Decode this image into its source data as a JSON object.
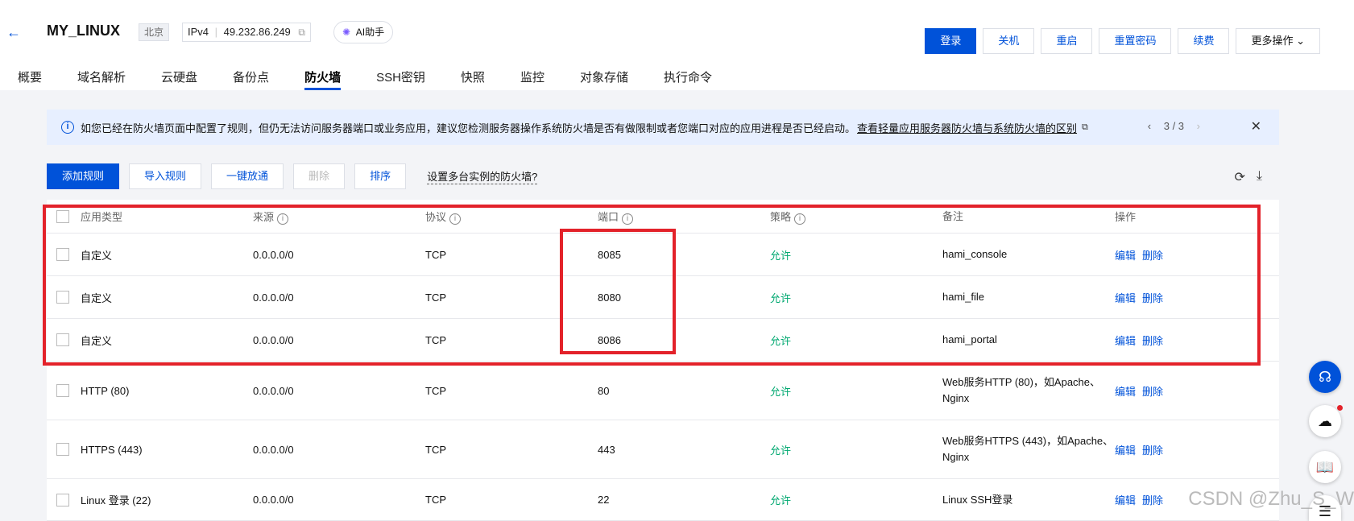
{
  "header": {
    "back_icon": "arrow-left-icon",
    "title": "MY_LINUX",
    "region": "北京",
    "ip_label": "IPv4",
    "ip_value": "49.232.86.249",
    "ai_label": "AI助手"
  },
  "actions": {
    "login": "登录",
    "shutdown": "关机",
    "restart": "重启",
    "reset_password": "重置密码",
    "renew": "续费",
    "more": "更多操作 ⌄"
  },
  "tabs": [
    {
      "label": "概要"
    },
    {
      "label": "域名解析"
    },
    {
      "label": "云硬盘"
    },
    {
      "label": "备份点"
    },
    {
      "label": "防火墙"
    },
    {
      "label": "SSH密钥"
    },
    {
      "label": "快照"
    },
    {
      "label": "监控"
    },
    {
      "label": "对象存储"
    },
    {
      "label": "执行命令"
    }
  ],
  "notice": {
    "text": "如您已经在防火墙页面中配置了规则，但仍无法访问服务器端口或业务应用，建议您检测服务器操作系统防火墙是否有做限制或者您端口对应的应用进程是否已经启动。",
    "link": "查看轻量应用服务器防火墙与系统防火墙的区别",
    "pager": "3 / 3"
  },
  "toolbar": {
    "add": "添加规则",
    "import": "导入规则",
    "allow_all": "一键放通",
    "delete": "删除",
    "sort": "排序",
    "multi": "设置多台实例的防火墙?"
  },
  "table": {
    "headers": {
      "app_type": "应用类型",
      "source": "来源",
      "protocol": "协议",
      "port": "端口",
      "policy": "策略",
      "remark": "备注",
      "operation": "操作"
    },
    "rows": [
      {
        "app": "自定义",
        "source": "0.0.0.0/0",
        "protocol": "TCP",
        "port": "8085",
        "policy": "允许",
        "remark": "hami_console",
        "edit": "编辑",
        "del": "删除"
      },
      {
        "app": "自定义",
        "source": "0.0.0.0/0",
        "protocol": "TCP",
        "port": "8080",
        "policy": "允许",
        "remark": "hami_file",
        "edit": "编辑",
        "del": "删除"
      },
      {
        "app": "自定义",
        "source": "0.0.0.0/0",
        "protocol": "TCP",
        "port": "8086",
        "policy": "允许",
        "remark": "hami_portal",
        "edit": "编辑",
        "del": "删除"
      },
      {
        "app": "HTTP (80)",
        "source": "0.0.0.0/0",
        "protocol": "TCP",
        "port": "80",
        "policy": "允许",
        "remark": "Web服务HTTP (80)，如Apache、Nginx",
        "edit": "编辑",
        "del": "删除"
      },
      {
        "app": "HTTPS (443)",
        "source": "0.0.0.0/0",
        "protocol": "TCP",
        "port": "443",
        "policy": "允许",
        "remark": "Web服务HTTPS (443)，如Apache、Nginx",
        "edit": "编辑",
        "del": "删除"
      },
      {
        "app": "Linux 登录 (22)",
        "source": "0.0.0.0/0",
        "protocol": "TCP",
        "port": "22",
        "policy": "允许",
        "remark": "Linux SSH登录",
        "edit": "编辑",
        "del": "删除"
      }
    ]
  },
  "watermark": "CSDN @Zhu_S_W",
  "accent_color": "#0052d9",
  "highlight_color": "#e3222a",
  "allow_color": "#00a870"
}
